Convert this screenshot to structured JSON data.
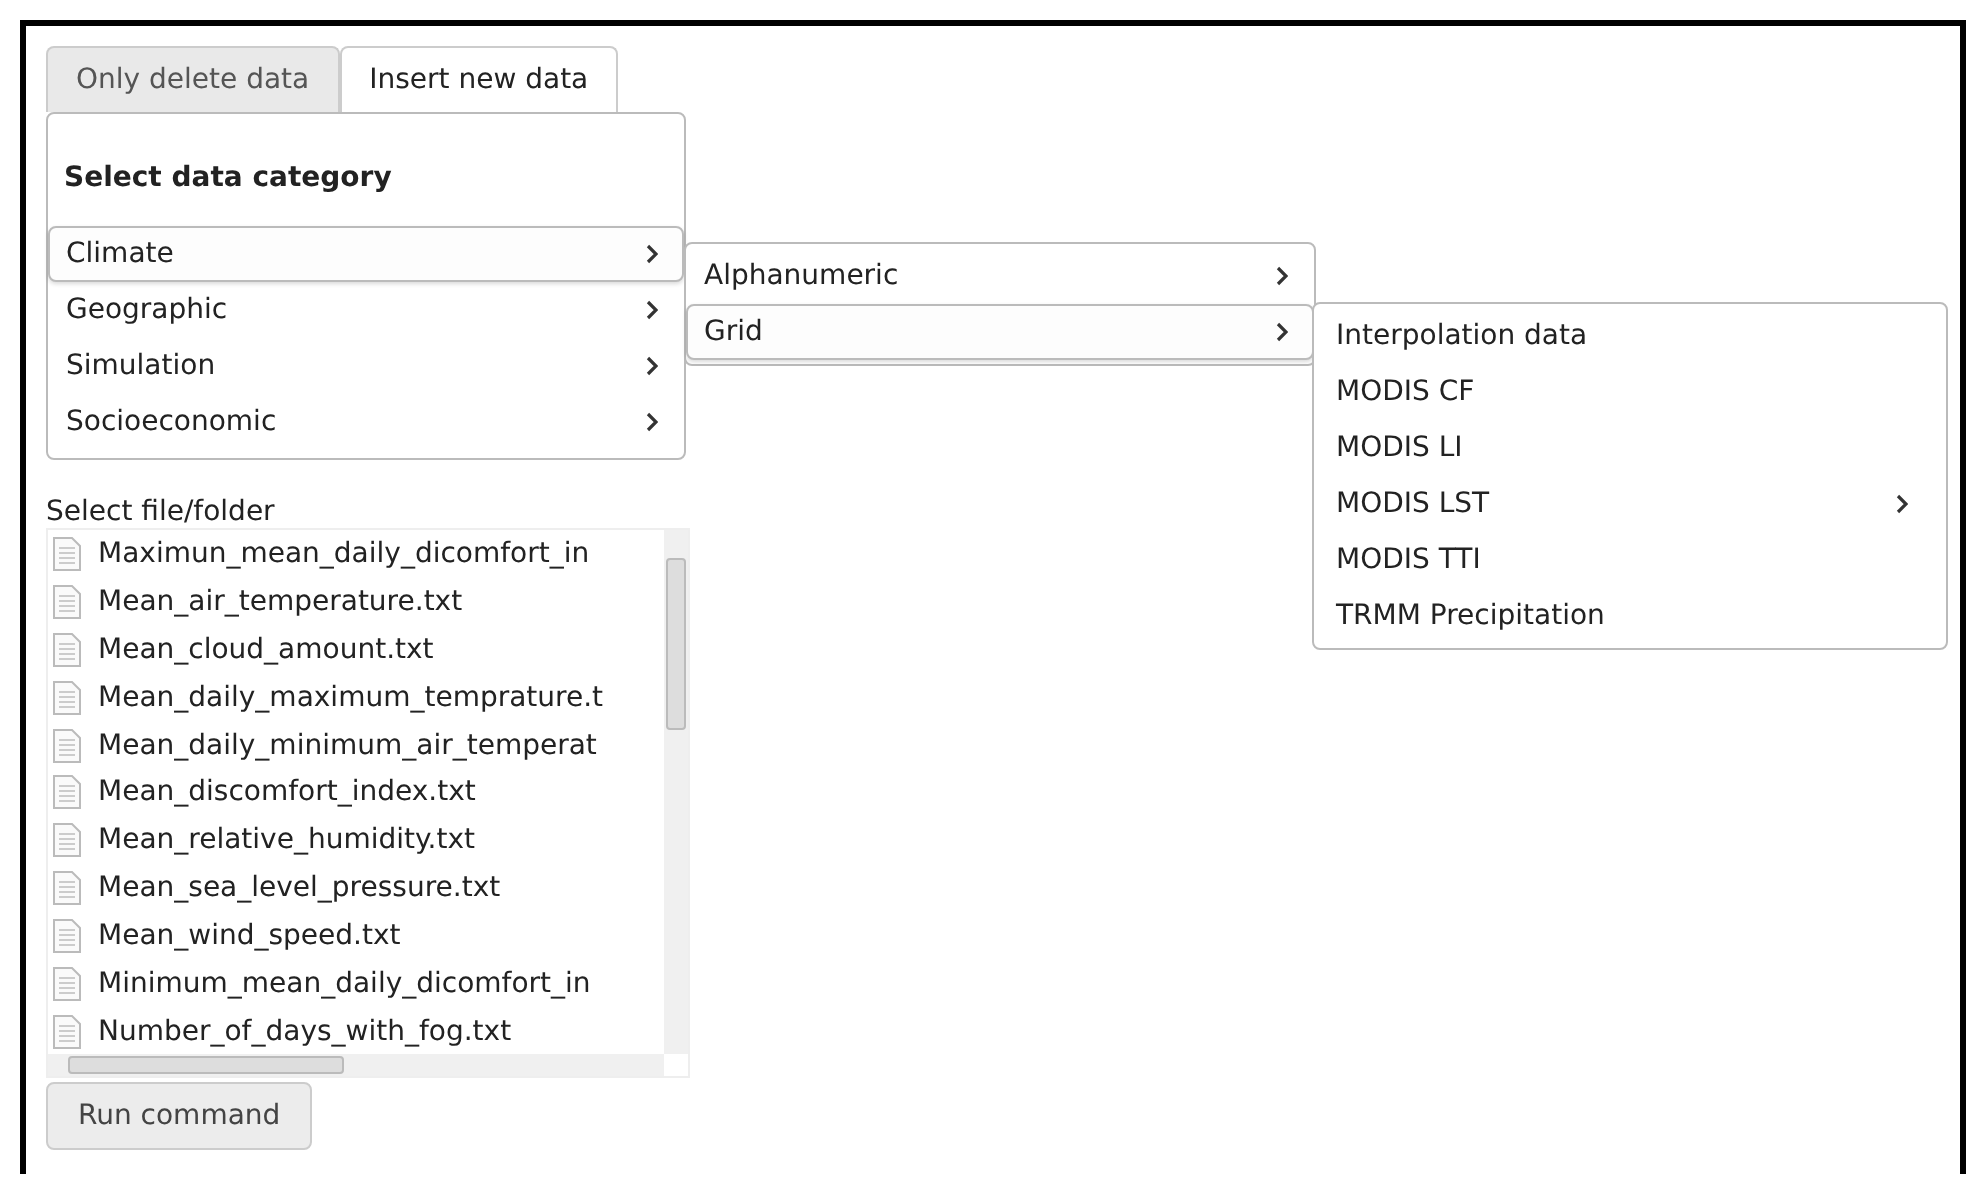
{
  "tabs": [
    {
      "label": "Only delete data",
      "selected": false
    },
    {
      "label": "Insert new data",
      "selected": true
    }
  ],
  "category_panel": {
    "heading": "Select data category",
    "items": [
      {
        "label": "Climate",
        "selected": true,
        "has_submenu": true
      },
      {
        "label": "Geographic",
        "selected": false,
        "has_submenu": true
      },
      {
        "label": "Simulation",
        "selected": false,
        "has_submenu": true
      },
      {
        "label": "Socioeconomic",
        "selected": false,
        "has_submenu": true
      }
    ]
  },
  "submenu_1": {
    "items": [
      {
        "label": "Alphanumeric",
        "selected": false,
        "has_submenu": true
      },
      {
        "label": "Grid",
        "selected": true,
        "has_submenu": true
      }
    ]
  },
  "submenu_2": {
    "items": [
      {
        "label": "Interpolation data",
        "selected": false,
        "has_submenu": false
      },
      {
        "label": "MODIS CF",
        "selected": false,
        "has_submenu": false
      },
      {
        "label": "MODIS LI",
        "selected": false,
        "has_submenu": false
      },
      {
        "label": "MODIS LST",
        "selected": false,
        "has_submenu": true
      },
      {
        "label": "MODIS TTI",
        "selected": false,
        "has_submenu": false
      },
      {
        "label": "TRMM Precipitation",
        "selected": false,
        "has_submenu": false
      }
    ]
  },
  "file_list": {
    "label": "Select file/folder",
    "files": [
      "Maximun_mean_daily_dicomfort_in",
      "Mean_air_temperature.txt",
      "Mean_cloud_amount.txt",
      "Mean_daily_maximum_temprature.t",
      "Mean_daily_minimum_air_temperat",
      "Mean_discomfort_index.txt",
      "Mean_relative_humidity.txt",
      "Mean_sea_level_pressure.txt",
      "Mean_wind_speed.txt",
      "Minimum_mean_daily_dicomfort_in",
      "Number_of_days_with_fog.txt"
    ]
  },
  "run_button": "Run command"
}
